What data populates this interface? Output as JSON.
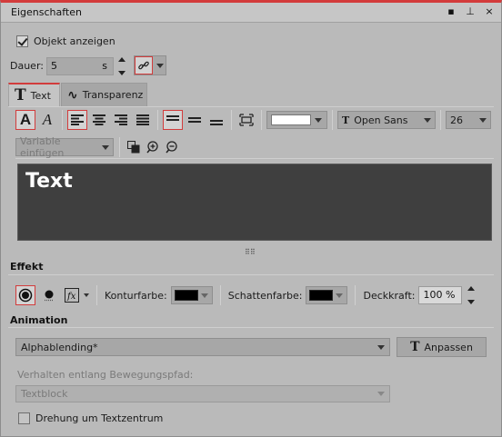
{
  "window": {
    "title": "Eigenschaften"
  },
  "object_visible": {
    "label": "Objekt anzeigen",
    "checked": true
  },
  "duration": {
    "label": "Dauer:",
    "value": "5",
    "unit": "s"
  },
  "tabs": [
    {
      "label": "Text",
      "active": true
    },
    {
      "label": "Transparenz",
      "active": false
    }
  ],
  "toolbar": {
    "font_name": "Open Sans",
    "font_size": "26",
    "color_value": "#ffffff"
  },
  "variable": {
    "placeholder": "Variable einfügen"
  },
  "text_preview": {
    "content": "Text"
  },
  "effect": {
    "section_title": "Effekt",
    "kontur_label": "Konturfarbe:",
    "kontur_color": "#000000",
    "schatten_label": "Schattenfarbe:",
    "schatten_color": "#000000",
    "deckkraft_label": "Deckkraft:",
    "deckkraft_value": "100 %"
  },
  "animation": {
    "section_title": "Animation",
    "selected": "Alphablending*",
    "adjust_button": "Anpassen",
    "path_label": "Verhalten entlang Bewegungspfad:",
    "path_value": "Textblock",
    "rotate_label": "Drehung um Textzentrum",
    "rotate_checked": false
  },
  "colors": {
    "accent": "#d23c3c",
    "preview_bg": "#3f3f3f"
  }
}
